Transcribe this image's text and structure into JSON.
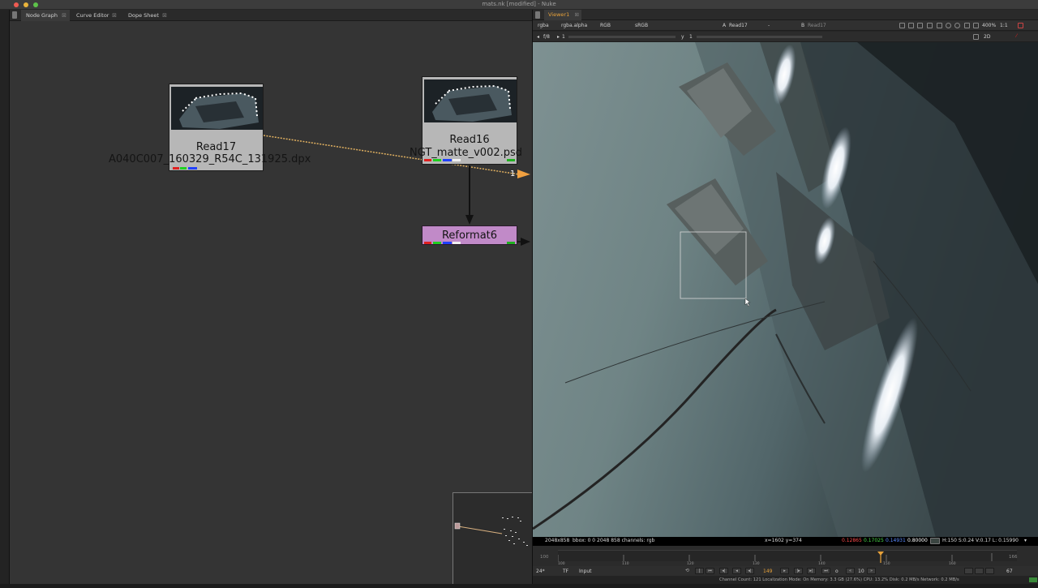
{
  "window": {
    "title": "mats.nk [modified] - Nuke"
  },
  "node_graph": {
    "tabs": [
      {
        "label": "Node Graph"
      },
      {
        "label": "Curve Editor"
      },
      {
        "label": "Dope Sheet"
      }
    ],
    "nodes": {
      "read17": {
        "name": "Read17",
        "file": "A040C007_160329_R54C_131925.dpx"
      },
      "read16": {
        "name": "Read16",
        "file": "NGT_matte_v002.psd"
      },
      "reformat6": {
        "name": "Reformat6"
      }
    },
    "pipe_input_label": "1"
  },
  "viewer": {
    "tab_label": "Viewer1",
    "toolbar1": {
      "channels": "rgba",
      "alpha_channel": "rgba.alpha",
      "display": "RGB",
      "colorspace": "sRGB",
      "a_label": "A",
      "a_input": "Read17",
      "a_op": "-",
      "b_label": "B",
      "b_input": "Read17",
      "zoom": "400%",
      "ratio": "1:1"
    },
    "toolbar2": {
      "fstop": "f/8",
      "frame": "1",
      "y_label": "y",
      "y_value": "1",
      "view_mode": "2D"
    },
    "info": {
      "format": "2048x858",
      "bbox": "bbox: 0 0 2048 858 channels: rgb",
      "coords": "x=1602 y=374",
      "r": "0.12865",
      "g": "0.17025",
      "b": "0.14931",
      "a": "0.80000",
      "hsvl": "H:150 S:0.24 V:0.17  L: 0.15990"
    },
    "timeline": {
      "start": "100",
      "end": "166",
      "ticks": [
        "100",
        "110",
        "120",
        "130",
        "140",
        "150",
        "160"
      ],
      "current": "149"
    },
    "playback": {
      "fps": "24*",
      "mode": "TF",
      "input_label": "Input",
      "frame": "149",
      "step": "10",
      "end_frame": "67"
    },
    "status": "Channel Count: 121  Localization Mode: On  Memory: 3.3 GB (27.6%)  CPU: 13.2%  Disk: 0.2 MB/s  Network: 0.2 MB/s"
  },
  "colors": {
    "accent_orange": "#e8a23a",
    "node_gray": "#b7b7b7",
    "reformat_purple": "#c18ac8",
    "info_red": "#ff4a4a",
    "info_green": "#4adc4a",
    "info_blue": "#4a7aff"
  }
}
